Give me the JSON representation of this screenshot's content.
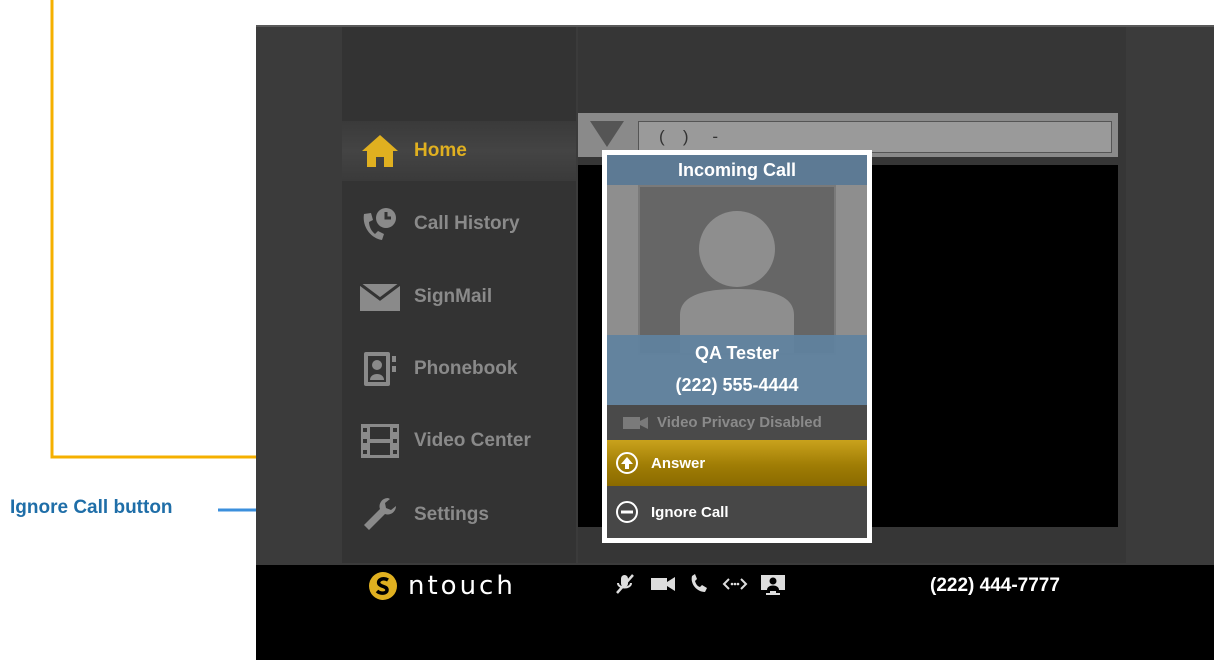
{
  "annotations": {
    "ignore_call_label": "Ignore Call button"
  },
  "sidebar": {
    "items": [
      {
        "label": "Home",
        "icon": "home-icon",
        "active": true
      },
      {
        "label": "Call History",
        "icon": "call-history-icon",
        "active": false
      },
      {
        "label": "SignMail",
        "icon": "envelope-icon",
        "active": false
      },
      {
        "label": "Phonebook",
        "icon": "phonebook-icon",
        "active": false
      },
      {
        "label": "Video Center",
        "icon": "film-icon",
        "active": false
      },
      {
        "label": "Settings",
        "icon": "wrench-icon",
        "active": false
      }
    ]
  },
  "dial_bar": {
    "value": "(   )    -"
  },
  "incoming_call": {
    "title": "Incoming Call",
    "caller_name": "QA Tester",
    "caller_number": "(222) 555-4444",
    "privacy_status": "Video Privacy Disabled",
    "answer_label": "Answer",
    "ignore_label": "Ignore Call"
  },
  "bottom_bar": {
    "brand": "ntouch",
    "my_number": "(222) 444-7777"
  },
  "colors": {
    "accent_gold": "#e0b020",
    "callout_gold": "#f5b000",
    "callout_blue": "#3b8fdc",
    "dialog_header": "#5d7a94"
  }
}
